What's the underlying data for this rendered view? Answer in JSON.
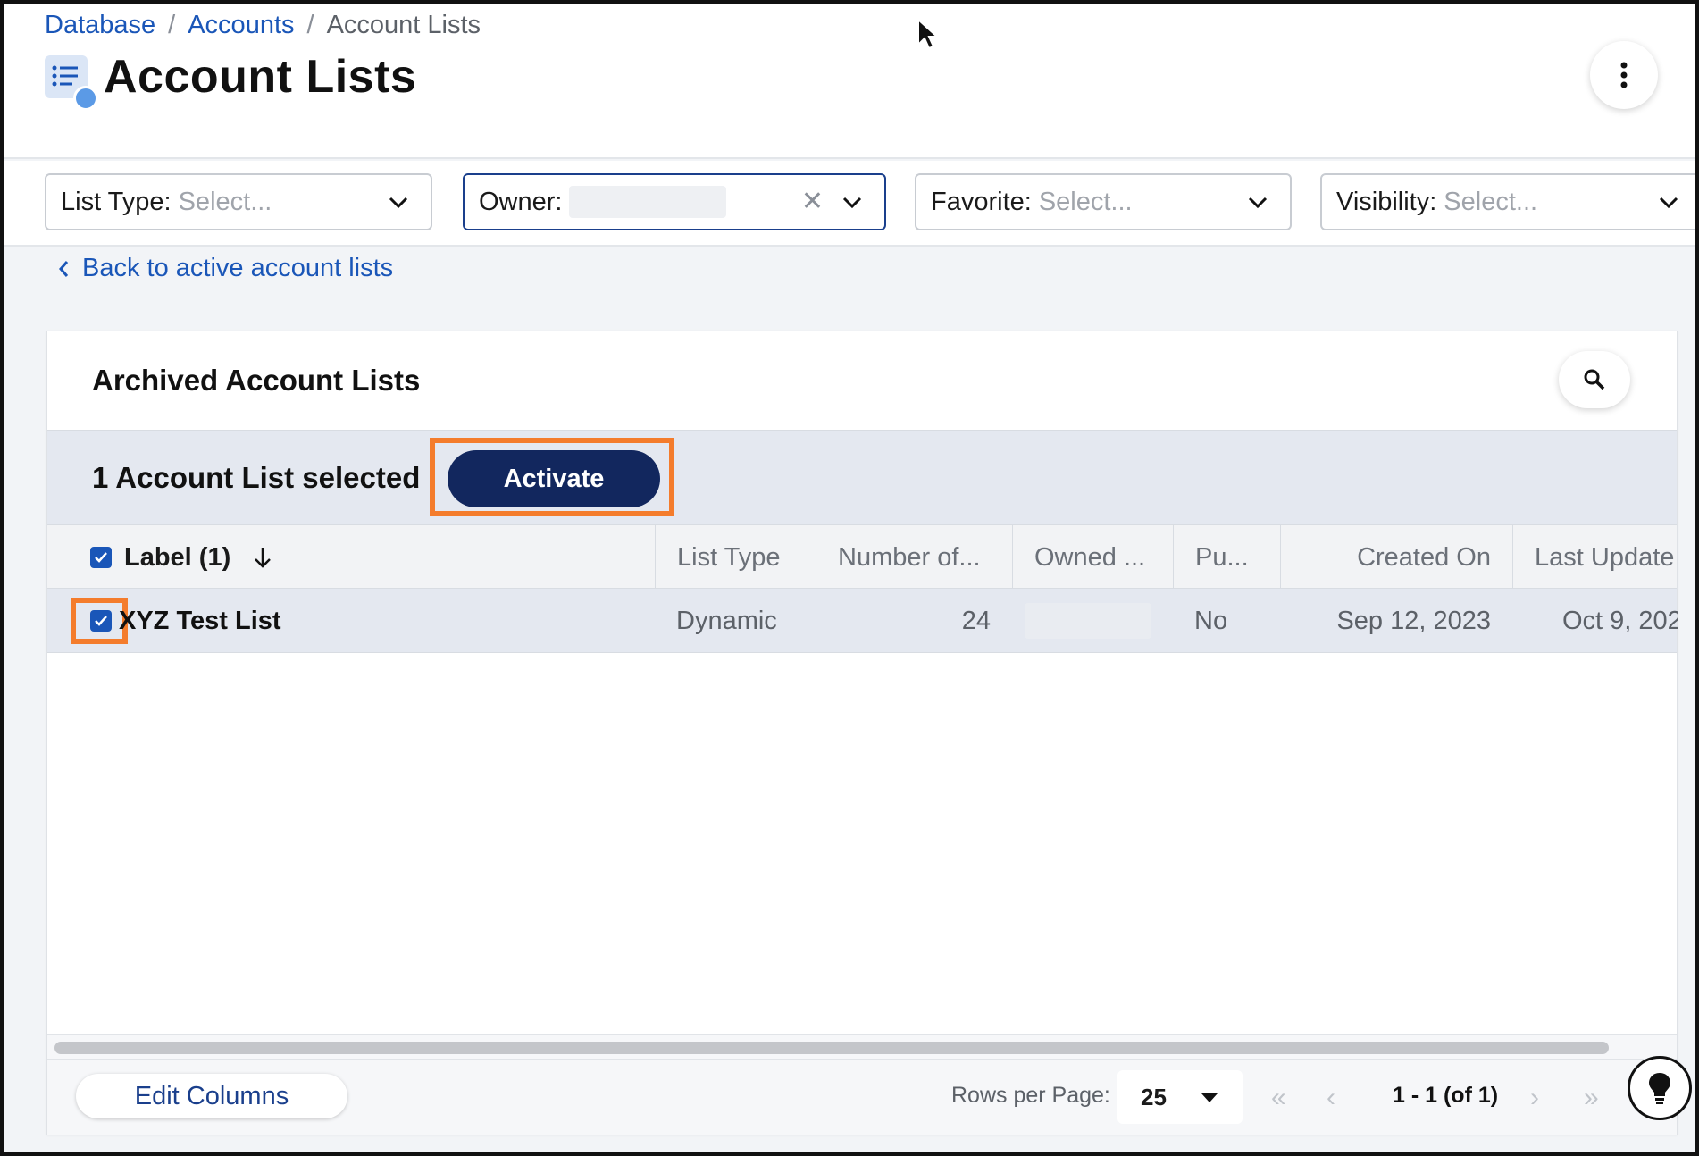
{
  "breadcrumb": {
    "items": [
      "Database",
      "Accounts",
      "Account Lists"
    ],
    "separator": "/"
  },
  "page": {
    "title": "Account Lists",
    "title_icon": "list-icon"
  },
  "filters": [
    {
      "label": "List Type:",
      "placeholder": "Select..."
    },
    {
      "label": "Owner:",
      "placeholder": ""
    },
    {
      "label": "Favorite:",
      "placeholder": "Select..."
    },
    {
      "label": "Visibility:",
      "placeholder": "Select..."
    }
  ],
  "back_link": "Back to active account lists",
  "card": {
    "title": "Archived Account Lists",
    "selection_text": "1 Account List selected",
    "activate_label": "Activate"
  },
  "table": {
    "columns": [
      "Label (1)",
      "List Type",
      "Number of...",
      "Owned ...",
      "Pu...",
      "Created On",
      "Last Update"
    ],
    "rows": [
      {
        "label": "XYZ Test List",
        "list_type": "Dynamic",
        "number": "24",
        "owner": "",
        "public": "No",
        "created_on": "Sep 12, 2023",
        "last_updated": "Oct 9, 202"
      }
    ]
  },
  "footer": {
    "edit_columns": "Edit Columns",
    "rows_per_page_label": "Rows per Page:",
    "rows_per_page_value": "25",
    "range": "1 - 1 (of 1)"
  },
  "colors": {
    "accent": "#1a56b8",
    "primary_button": "#12275e",
    "highlight": "#f47c2c"
  }
}
